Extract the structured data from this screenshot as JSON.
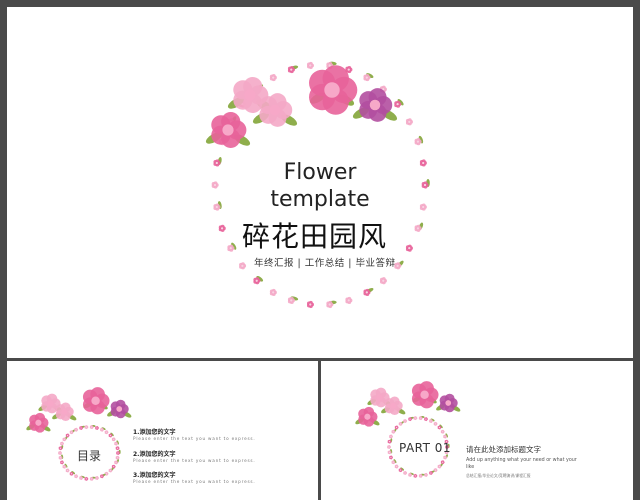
{
  "main": {
    "title_line1": "Flower",
    "title_line2": "template",
    "title_cn": "碎花田园风",
    "subtitle": "年终汇报 | 工作总结 | 毕业答辩"
  },
  "toc": {
    "title": "目录",
    "items": [
      {
        "label": "1.添加您的文字",
        "desc": "Please enter the text you want to express."
      },
      {
        "label": "2.添加您的文字",
        "desc": "Please enter the text you want to express."
      },
      {
        "label": "3.添加您的文字",
        "desc": "Please enter the text you want to express."
      }
    ]
  },
  "part": {
    "title": "PART 01",
    "heading": "请在此处添加标题文字",
    "desc": "Add up anything what your need or what your like",
    "small": "总结汇报/毕业论文/竞聘演讲/课程汇报"
  },
  "colors": {
    "background": "#4a4a4a",
    "slide": "#ffffff",
    "flower_pink": "#e8639a",
    "flower_light": "#f4a9c6",
    "leaf": "#8fae4c"
  }
}
